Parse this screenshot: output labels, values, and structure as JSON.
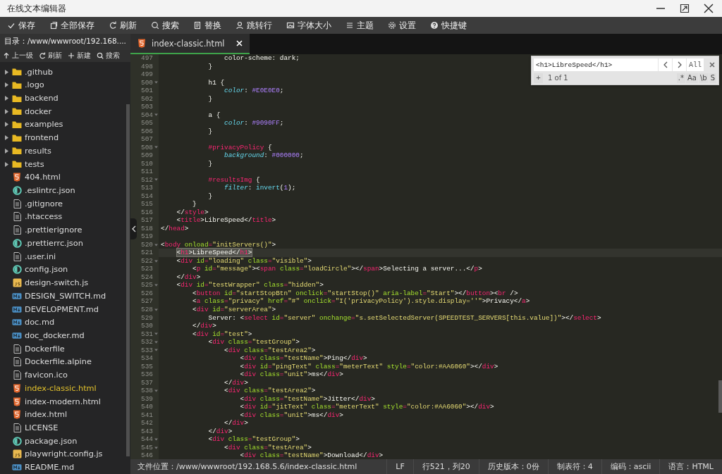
{
  "window": {
    "title": "在线文本编辑器"
  },
  "toolbar": [
    {
      "label": "保存"
    },
    {
      "label": "全部保存"
    },
    {
      "label": "刷新"
    },
    {
      "label": "搜索"
    },
    {
      "label": "替换"
    },
    {
      "label": "跳转行"
    },
    {
      "label": "字体大小"
    },
    {
      "label": "主题"
    },
    {
      "label": "设置"
    },
    {
      "label": "快捷键"
    }
  ],
  "sidebar": {
    "path": "目录：/www/wwwroot/192.168....",
    "tools": [
      {
        "label": "上一级"
      },
      {
        "label": "刷新"
      },
      {
        "label": "新建"
      },
      {
        "label": "搜索"
      }
    ],
    "items": [
      {
        "name": ".github",
        "kind": "folder",
        "expanded": false,
        "selected": false
      },
      {
        "name": ".logo",
        "kind": "folder",
        "expanded": false,
        "selected": false
      },
      {
        "name": "backend",
        "kind": "folder",
        "expanded": false,
        "selected": false
      },
      {
        "name": "docker",
        "kind": "folder",
        "expanded": false,
        "selected": false
      },
      {
        "name": "examples",
        "kind": "folder",
        "expanded": false,
        "selected": false
      },
      {
        "name": "frontend",
        "kind": "folder",
        "expanded": false,
        "selected": false
      },
      {
        "name": "results",
        "kind": "folder",
        "expanded": false,
        "selected": false
      },
      {
        "name": "tests",
        "kind": "folder",
        "expanded": false,
        "selected": false
      },
      {
        "name": "404.html",
        "kind": "html",
        "selected": false
      },
      {
        "name": ".eslintrc.json",
        "kind": "json",
        "selected": false
      },
      {
        "name": ".gitignore",
        "kind": "text",
        "selected": false
      },
      {
        "name": ".htaccess",
        "kind": "text",
        "selected": false
      },
      {
        "name": ".prettierignore",
        "kind": "text",
        "selected": false
      },
      {
        "name": ".prettierrc.json",
        "kind": "json",
        "selected": false
      },
      {
        "name": ".user.ini",
        "kind": "text",
        "selected": false
      },
      {
        "name": "config.json",
        "kind": "json",
        "selected": false
      },
      {
        "name": "design-switch.js",
        "kind": "js",
        "selected": false
      },
      {
        "name": "DESIGN_SWITCH.md",
        "kind": "md",
        "selected": false
      },
      {
        "name": "DEVELOPMENT.md",
        "kind": "md",
        "selected": false
      },
      {
        "name": "doc.md",
        "kind": "md",
        "selected": false
      },
      {
        "name": "doc_docker.md",
        "kind": "md",
        "selected": false
      },
      {
        "name": "Dockerfile",
        "kind": "text",
        "selected": false
      },
      {
        "name": "Dockerfile.alpine",
        "kind": "text",
        "selected": false
      },
      {
        "name": "favicon.ico",
        "kind": "text",
        "selected": false
      },
      {
        "name": "index-classic.html",
        "kind": "html",
        "selected": true
      },
      {
        "name": "index-modern.html",
        "kind": "html",
        "selected": false
      },
      {
        "name": "index.html",
        "kind": "html",
        "selected": false
      },
      {
        "name": "LICENSE",
        "kind": "text",
        "selected": false
      },
      {
        "name": "package.json",
        "kind": "json",
        "selected": false
      },
      {
        "name": "playwright.config.js",
        "kind": "js",
        "selected": false
      },
      {
        "name": "README.md",
        "kind": "md",
        "selected": false
      }
    ]
  },
  "tabs": [
    {
      "label": "index-classic.html",
      "selected": true
    }
  ],
  "editor": {
    "lines": [
      {
        "number": "497",
        "fold": false,
        "current": false,
        "match": false,
        "tokens": [
          {
            "kind": "text",
            "text": "                color-scheme: dark;"
          }
        ]
      },
      {
        "number": "498",
        "fold": false,
        "current": false,
        "match": false,
        "tokens": [
          {
            "kind": "text",
            "text": "            }"
          }
        ]
      },
      {
        "number": "499",
        "fold": false,
        "current": false,
        "match": false
      },
      {
        "number": "500",
        "fold": true,
        "current": false,
        "match": false,
        "tokens": [
          {
            "kind": "text",
            "text": "            h1 {"
          }
        ]
      },
      {
        "number": "501",
        "fold": false,
        "current": false,
        "match": false,
        "tokens": [
          {
            "kind": "prop",
            "text": "                color"
          },
          {
            "kind": "text",
            "text": ": "
          },
          {
            "kind": "num",
            "text": "#E0E0E0"
          },
          {
            "kind": "text",
            "text": ";"
          }
        ]
      },
      {
        "number": "502",
        "fold": false,
        "current": false,
        "match": false,
        "tokens": [
          {
            "kind": "text",
            "text": "            }"
          }
        ]
      },
      {
        "number": "503",
        "fold": false,
        "current": false,
        "match": false
      },
      {
        "number": "504",
        "fold": true,
        "current": false,
        "match": false,
        "tokens": [
          {
            "kind": "text",
            "text": "            a {"
          }
        ]
      },
      {
        "number": "505",
        "fold": false,
        "current": false,
        "match": false,
        "tokens": [
          {
            "kind": "prop",
            "text": "                color"
          },
          {
            "kind": "text",
            "text": ": "
          },
          {
            "kind": "num",
            "text": "#9090FF"
          },
          {
            "kind": "text",
            "text": ";"
          }
        ]
      },
      {
        "number": "506",
        "fold": false,
        "current": false,
        "match": false,
        "tokens": [
          {
            "kind": "text",
            "text": "            }"
          }
        ]
      },
      {
        "number": "507",
        "fold": false,
        "current": false,
        "match": false
      },
      {
        "number": "508",
        "fold": true,
        "current": false,
        "match": false,
        "tokens": [
          {
            "kind": "sel",
            "text": "            #privacyPolicy"
          },
          {
            "kind": "text",
            "text": " {"
          }
        ]
      },
      {
        "number": "509",
        "fold": false,
        "current": false,
        "match": false,
        "tokens": [
          {
            "kind": "prop",
            "text": "                background"
          },
          {
            "kind": "text",
            "text": ": "
          },
          {
            "kind": "num",
            "text": "#000000"
          },
          {
            "kind": "text",
            "text": ";"
          }
        ]
      },
      {
        "number": "510",
        "fold": false,
        "current": false,
        "match": false,
        "tokens": [
          {
            "kind": "text",
            "text": "            }"
          }
        ]
      },
      {
        "number": "511",
        "fold": false,
        "current": false,
        "match": false
      },
      {
        "number": "512",
        "fold": true,
        "current": false,
        "match": false,
        "tokens": [
          {
            "kind": "sel",
            "text": "            #resultsImg"
          },
          {
            "kind": "text",
            "text": " {"
          }
        ]
      },
      {
        "number": "513",
        "fold": false,
        "current": false,
        "match": false,
        "tokens": [
          {
            "kind": "prop",
            "text": "                filter"
          },
          {
            "kind": "text",
            "text": ": "
          },
          {
            "kind": "fn",
            "text": "invert"
          },
          {
            "kind": "text",
            "text": "("
          },
          {
            "kind": "num",
            "text": "1"
          },
          {
            "kind": "text",
            "text": ");"
          }
        ]
      },
      {
        "number": "514",
        "fold": false,
        "current": false,
        "match": false,
        "tokens": [
          {
            "kind": "text",
            "text": "            }"
          }
        ]
      },
      {
        "number": "515",
        "fold": false,
        "current": false,
        "match": false,
        "tokens": [
          {
            "kind": "text",
            "text": "        }"
          }
        ]
      },
      {
        "number": "516",
        "fold": false,
        "current": false,
        "match": false,
        "tokens": [
          {
            "kind": "text",
            "text": "    </"
          },
          {
            "kind": "tag",
            "text": "style"
          },
          {
            "kind": "text",
            "text": ">"
          }
        ]
      },
      {
        "number": "517",
        "fold": false,
        "current": false,
        "match": false,
        "tokens": [
          {
            "kind": "text",
            "text": "    <"
          },
          {
            "kind": "tag",
            "text": "title"
          },
          {
            "kind": "text",
            "text": ">LibreSpeed</"
          },
          {
            "kind": "tag",
            "text": "title"
          },
          {
            "kind": "text",
            "text": ">"
          }
        ]
      },
      {
        "number": "518",
        "fold": false,
        "current": false,
        "match": false,
        "tokens": [
          {
            "kind": "text",
            "text": "</"
          },
          {
            "kind": "tag",
            "text": "head"
          },
          {
            "kind": "text",
            "text": ">"
          }
        ]
      },
      {
        "number": "519",
        "fold": false,
        "current": false,
        "match": false
      },
      {
        "number": "520",
        "fold": true,
        "current": false,
        "match": false,
        "tokens": [
          {
            "kind": "text",
            "text": "<"
          },
          {
            "kind": "tag",
            "text": "body"
          },
          {
            "kind": "attr",
            "text": " onload"
          },
          {
            "kind": "op",
            "text": "="
          },
          {
            "kind": "str",
            "text": "\"initServers()\""
          },
          {
            "kind": "text",
            "text": ">"
          }
        ]
      },
      {
        "number": "521",
        "fold": false,
        "current": true,
        "match": true,
        "tokens": [
          {
            "kind": "text",
            "text": "    <"
          },
          {
            "kind": "tag",
            "text": "h1"
          },
          {
            "kind": "text",
            "text": ">LibreSpeed</"
          },
          {
            "kind": "tag",
            "text": "h1"
          },
          {
            "kind": "text",
            "text": ">"
          }
        ]
      },
      {
        "number": "522",
        "fold": true,
        "current": false,
        "match": false,
        "tokens": [
          {
            "kind": "text",
            "text": "    <"
          },
          {
            "kind": "tag",
            "text": "div"
          },
          {
            "kind": "attr",
            "text": " id"
          },
          {
            "kind": "op",
            "text": "="
          },
          {
            "kind": "str",
            "text": "\"loading\""
          },
          {
            "kind": "attr",
            "text": " class"
          },
          {
            "kind": "op",
            "text": "="
          },
          {
            "kind": "str",
            "text": "\"visible\""
          },
          {
            "kind": "text",
            "text": ">"
          }
        ]
      },
      {
        "number": "523",
        "fold": false,
        "current": false,
        "match": false,
        "tokens": [
          {
            "kind": "text",
            "text": "        <"
          },
          {
            "kind": "tag",
            "text": "p"
          },
          {
            "kind": "attr",
            "text": " id"
          },
          {
            "kind": "op",
            "text": "="
          },
          {
            "kind": "str",
            "text": "\"message\""
          },
          {
            "kind": "text",
            "text": "><"
          },
          {
            "kind": "tag",
            "text": "span"
          },
          {
            "kind": "attr",
            "text": " class"
          },
          {
            "kind": "op",
            "text": "="
          },
          {
            "kind": "str",
            "text": "\"loadCircle\""
          },
          {
            "kind": "text",
            "text": "></"
          },
          {
            "kind": "tag",
            "text": "span"
          },
          {
            "kind": "text",
            "text": ">Selecting a server...</"
          },
          {
            "kind": "tag",
            "text": "p"
          },
          {
            "kind": "text",
            "text": ">"
          }
        ]
      },
      {
        "number": "524",
        "fold": false,
        "current": false,
        "match": false,
        "tokens": [
          {
            "kind": "text",
            "text": "    </"
          },
          {
            "kind": "tag",
            "text": "div"
          },
          {
            "kind": "text",
            "text": ">"
          }
        ]
      },
      {
        "number": "525",
        "fold": true,
        "current": false,
        "match": false,
        "tokens": [
          {
            "kind": "text",
            "text": "    <"
          },
          {
            "kind": "tag",
            "text": "div"
          },
          {
            "kind": "attr",
            "text": " id"
          },
          {
            "kind": "op",
            "text": "="
          },
          {
            "kind": "str",
            "text": "\"testWrapper\""
          },
          {
            "kind": "attr",
            "text": " class"
          },
          {
            "kind": "op",
            "text": "="
          },
          {
            "kind": "str",
            "text": "\"hidden\""
          },
          {
            "kind": "text",
            "text": ">"
          }
        ]
      },
      {
        "number": "526",
        "fold": false,
        "current": false,
        "match": false,
        "tokens": [
          {
            "kind": "text",
            "text": "        <"
          },
          {
            "kind": "tag",
            "text": "button"
          },
          {
            "kind": "attr",
            "text": " id"
          },
          {
            "kind": "op",
            "text": "="
          },
          {
            "kind": "str",
            "text": "\"startStopBtn\""
          },
          {
            "kind": "attr",
            "text": " onclick"
          },
          {
            "kind": "op",
            "text": "="
          },
          {
            "kind": "str",
            "text": "\"startStop()\""
          },
          {
            "kind": "attr",
            "text": " aria-label"
          },
          {
            "kind": "op",
            "text": "="
          },
          {
            "kind": "str",
            "text": "\"Start\""
          },
          {
            "kind": "text",
            "text": "></"
          },
          {
            "kind": "tag",
            "text": "button"
          },
          {
            "kind": "text",
            "text": "><"
          },
          {
            "kind": "tag",
            "text": "br"
          },
          {
            "kind": "text",
            "text": " />"
          }
        ]
      },
      {
        "number": "527",
        "fold": false,
        "current": false,
        "match": false,
        "tokens": [
          {
            "kind": "text",
            "text": "        <"
          },
          {
            "kind": "tag",
            "text": "a"
          },
          {
            "kind": "attr",
            "text": " class"
          },
          {
            "kind": "op",
            "text": "="
          },
          {
            "kind": "str",
            "text": "\"privacy\""
          },
          {
            "kind": "attr",
            "text": " href"
          },
          {
            "kind": "op",
            "text": "="
          },
          {
            "kind": "str",
            "text": "\"#\""
          },
          {
            "kind": "attr",
            "text": " onclick"
          },
          {
            "kind": "op",
            "text": "="
          },
          {
            "kind": "str",
            "text": "\"I('privacyPolicy').style.display=''\""
          },
          {
            "kind": "text",
            "text": ">Privacy</"
          },
          {
            "kind": "tag",
            "text": "a"
          },
          {
            "kind": "text",
            "text": ">"
          }
        ]
      },
      {
        "number": "528",
        "fold": true,
        "current": false,
        "match": false,
        "tokens": [
          {
            "kind": "text",
            "text": "        <"
          },
          {
            "kind": "tag",
            "text": "div"
          },
          {
            "kind": "attr",
            "text": " id"
          },
          {
            "kind": "op",
            "text": "="
          },
          {
            "kind": "str",
            "text": "\"serverArea\""
          },
          {
            "kind": "text",
            "text": ">"
          }
        ]
      },
      {
        "number": "529",
        "fold": false,
        "current": false,
        "match": false,
        "tokens": [
          {
            "kind": "text",
            "text": "            Server: <"
          },
          {
            "kind": "tag",
            "text": "select"
          },
          {
            "kind": "attr",
            "text": " id"
          },
          {
            "kind": "op",
            "text": "="
          },
          {
            "kind": "str",
            "text": "\"server\""
          },
          {
            "kind": "attr",
            "text": " onchange"
          },
          {
            "kind": "op",
            "text": "="
          },
          {
            "kind": "str",
            "text": "\"s.setSelectedServer(SPEEDTEST_SERVERS[this.value])\""
          },
          {
            "kind": "text",
            "text": "></"
          },
          {
            "kind": "tag",
            "text": "select"
          },
          {
            "kind": "text",
            "text": ">"
          }
        ]
      },
      {
        "number": "530",
        "fold": false,
        "current": false,
        "match": false,
        "tokens": [
          {
            "kind": "text",
            "text": "        </"
          },
          {
            "kind": "tag",
            "text": "div"
          },
          {
            "kind": "text",
            "text": ">"
          }
        ]
      },
      {
        "number": "531",
        "fold": true,
        "current": false,
        "match": false,
        "tokens": [
          {
            "kind": "text",
            "text": "        <"
          },
          {
            "kind": "tag",
            "text": "div"
          },
          {
            "kind": "attr",
            "text": " id"
          },
          {
            "kind": "op",
            "text": "="
          },
          {
            "kind": "str",
            "text": "\"test\""
          },
          {
            "kind": "text",
            "text": ">"
          }
        ]
      },
      {
        "number": "532",
        "fold": true,
        "current": false,
        "match": false,
        "tokens": [
          {
            "kind": "text",
            "text": "            <"
          },
          {
            "kind": "tag",
            "text": "div"
          },
          {
            "kind": "attr",
            "text": " class"
          },
          {
            "kind": "op",
            "text": "="
          },
          {
            "kind": "str",
            "text": "\"testGroup\""
          },
          {
            "kind": "text",
            "text": ">"
          }
        ]
      },
      {
        "number": "533",
        "fold": true,
        "current": false,
        "match": false,
        "tokens": [
          {
            "kind": "text",
            "text": "                <"
          },
          {
            "kind": "tag",
            "text": "div"
          },
          {
            "kind": "attr",
            "text": " class"
          },
          {
            "kind": "op",
            "text": "="
          },
          {
            "kind": "str",
            "text": "\"testArea2\""
          },
          {
            "kind": "text",
            "text": ">"
          }
        ]
      },
      {
        "number": "534",
        "fold": false,
        "current": false,
        "match": false,
        "tokens": [
          {
            "kind": "text",
            "text": "                    <"
          },
          {
            "kind": "tag",
            "text": "div"
          },
          {
            "kind": "attr",
            "text": " class"
          },
          {
            "kind": "op",
            "text": "="
          },
          {
            "kind": "str",
            "text": "\"testName\""
          },
          {
            "kind": "text",
            "text": ">Ping</"
          },
          {
            "kind": "tag",
            "text": "div"
          },
          {
            "kind": "text",
            "text": ">"
          }
        ]
      },
      {
        "number": "535",
        "fold": false,
        "current": false,
        "match": false,
        "tokens": [
          {
            "kind": "text",
            "text": "                    <"
          },
          {
            "kind": "tag",
            "text": "div"
          },
          {
            "kind": "attr",
            "text": " id"
          },
          {
            "kind": "op",
            "text": "="
          },
          {
            "kind": "str",
            "text": "\"pingText\""
          },
          {
            "kind": "attr",
            "text": " class"
          },
          {
            "kind": "op",
            "text": "="
          },
          {
            "kind": "str",
            "text": "\"meterText\""
          },
          {
            "kind": "attr",
            "text": " style"
          },
          {
            "kind": "op",
            "text": "="
          },
          {
            "kind": "str",
            "text": "\"color:#AA6060\""
          },
          {
            "kind": "text",
            "text": "></"
          },
          {
            "kind": "tag",
            "text": "div"
          },
          {
            "kind": "text",
            "text": ">"
          }
        ]
      },
      {
        "number": "536",
        "fold": false,
        "current": false,
        "match": false,
        "tokens": [
          {
            "kind": "text",
            "text": "                    <"
          },
          {
            "kind": "tag",
            "text": "div"
          },
          {
            "kind": "attr",
            "text": " class"
          },
          {
            "kind": "op",
            "text": "="
          },
          {
            "kind": "str",
            "text": "\"unit\""
          },
          {
            "kind": "text",
            "text": ">ms</"
          },
          {
            "kind": "tag",
            "text": "div"
          },
          {
            "kind": "text",
            "text": ">"
          }
        ]
      },
      {
        "number": "537",
        "fold": false,
        "current": false,
        "match": false,
        "tokens": [
          {
            "kind": "text",
            "text": "                </"
          },
          {
            "kind": "tag",
            "text": "div"
          },
          {
            "kind": "text",
            "text": ">"
          }
        ]
      },
      {
        "number": "538",
        "fold": true,
        "current": false,
        "match": false,
        "tokens": [
          {
            "kind": "text",
            "text": "                <"
          },
          {
            "kind": "tag",
            "text": "div"
          },
          {
            "kind": "attr",
            "text": " class"
          },
          {
            "kind": "op",
            "text": "="
          },
          {
            "kind": "str",
            "text": "\"testArea2\""
          },
          {
            "kind": "text",
            "text": ">"
          }
        ]
      },
      {
        "number": "539",
        "fold": false,
        "current": false,
        "match": false,
        "tokens": [
          {
            "kind": "text",
            "text": "                    <"
          },
          {
            "kind": "tag",
            "text": "div"
          },
          {
            "kind": "attr",
            "text": " class"
          },
          {
            "kind": "op",
            "text": "="
          },
          {
            "kind": "str",
            "text": "\"testName\""
          },
          {
            "kind": "text",
            "text": ">Jitter</"
          },
          {
            "kind": "tag",
            "text": "div"
          },
          {
            "kind": "text",
            "text": ">"
          }
        ]
      },
      {
        "number": "540",
        "fold": false,
        "current": false,
        "match": false,
        "tokens": [
          {
            "kind": "text",
            "text": "                    <"
          },
          {
            "kind": "tag",
            "text": "div"
          },
          {
            "kind": "attr",
            "text": " id"
          },
          {
            "kind": "op",
            "text": "="
          },
          {
            "kind": "str",
            "text": "\"jitText\""
          },
          {
            "kind": "attr",
            "text": " class"
          },
          {
            "kind": "op",
            "text": "="
          },
          {
            "kind": "str",
            "text": "\"meterText\""
          },
          {
            "kind": "attr",
            "text": " style"
          },
          {
            "kind": "op",
            "text": "="
          },
          {
            "kind": "str",
            "text": "\"color:#AA6060\""
          },
          {
            "kind": "text",
            "text": "></"
          },
          {
            "kind": "tag",
            "text": "div"
          },
          {
            "kind": "text",
            "text": ">"
          }
        ]
      },
      {
        "number": "541",
        "fold": false,
        "current": false,
        "match": false,
        "tokens": [
          {
            "kind": "text",
            "text": "                    <"
          },
          {
            "kind": "tag",
            "text": "div"
          },
          {
            "kind": "attr",
            "text": " class"
          },
          {
            "kind": "op",
            "text": "="
          },
          {
            "kind": "str",
            "text": "\"unit\""
          },
          {
            "kind": "text",
            "text": ">ms</"
          },
          {
            "kind": "tag",
            "text": "div"
          },
          {
            "kind": "text",
            "text": ">"
          }
        ]
      },
      {
        "number": "542",
        "fold": false,
        "current": false,
        "match": false,
        "tokens": [
          {
            "kind": "text",
            "text": "                </"
          },
          {
            "kind": "tag",
            "text": "div"
          },
          {
            "kind": "text",
            "text": ">"
          }
        ]
      },
      {
        "number": "543",
        "fold": false,
        "current": false,
        "match": false,
        "tokens": [
          {
            "kind": "text",
            "text": "            </"
          },
          {
            "kind": "tag",
            "text": "div"
          },
          {
            "kind": "text",
            "text": ">"
          }
        ]
      },
      {
        "number": "544",
        "fold": true,
        "current": false,
        "match": false,
        "tokens": [
          {
            "kind": "text",
            "text": "            <"
          },
          {
            "kind": "tag",
            "text": "div"
          },
          {
            "kind": "attr",
            "text": " class"
          },
          {
            "kind": "op",
            "text": "="
          },
          {
            "kind": "str",
            "text": "\"testGroup\""
          },
          {
            "kind": "text",
            "text": ">"
          }
        ]
      },
      {
        "number": "545",
        "fold": true,
        "current": false,
        "match": false,
        "tokens": [
          {
            "kind": "text",
            "text": "                <"
          },
          {
            "kind": "tag",
            "text": "div"
          },
          {
            "kind": "attr",
            "text": " class"
          },
          {
            "kind": "op",
            "text": "="
          },
          {
            "kind": "str",
            "text": "\"testArea\""
          },
          {
            "kind": "text",
            "text": ">"
          }
        ]
      },
      {
        "number": "546",
        "fold": false,
        "current": false,
        "match": false,
        "tokens": [
          {
            "kind": "text",
            "text": "                    <"
          },
          {
            "kind": "tag",
            "text": "div"
          },
          {
            "kind": "attr",
            "text": " class"
          },
          {
            "kind": "op",
            "text": "="
          },
          {
            "kind": "str",
            "text": "\"testName\""
          },
          {
            "kind": "text",
            "text": ">Download</"
          },
          {
            "kind": "tag",
            "text": "div"
          },
          {
            "kind": "text",
            "text": ">"
          }
        ]
      }
    ]
  },
  "search_panel": {
    "value": "<h1>LibreSpeed</h1>",
    "all_button": "All",
    "add_button": "+",
    "result": "1 of 1",
    "options": [
      {
        "label": ".*"
      },
      {
        "label": "Aa"
      },
      {
        "label": "\\b"
      },
      {
        "label": "S"
      }
    ]
  },
  "status_bar": [
    "文件位置：/www/wwwroot/192.168.5.6/index-classic.html",
    "LF",
    "行521，列20",
    "历史版本：0份",
    "制表符：4",
    "编码：ascii",
    "语言：HTML"
  ]
}
